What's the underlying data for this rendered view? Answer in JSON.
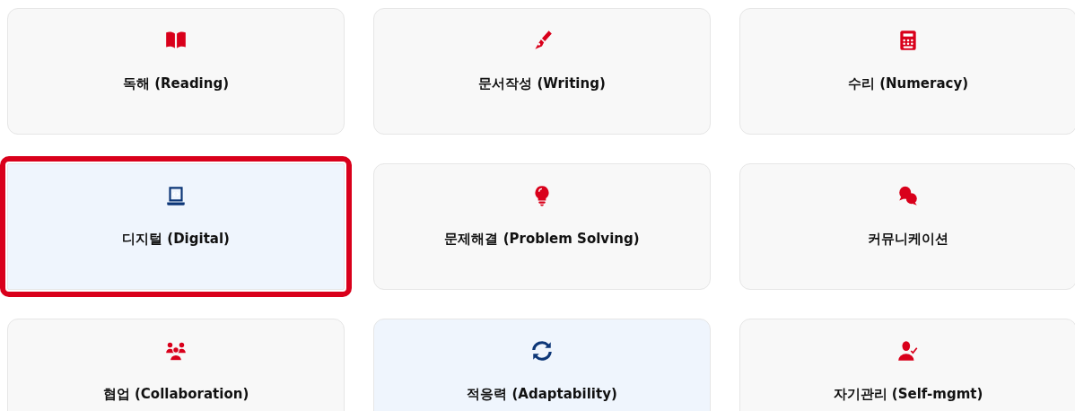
{
  "cards": [
    {
      "label": "독해 (Reading)",
      "selected": false,
      "hovered": false
    },
    {
      "label": "문서작성 (Writing)",
      "selected": false,
      "hovered": false
    },
    {
      "label": "수리 (Numeracy)",
      "selected": false,
      "hovered": false
    },
    {
      "label": "디지털 (Digital)",
      "selected": true,
      "hovered": false
    },
    {
      "label": "문제해결 (Problem Solving)",
      "selected": false,
      "hovered": false
    },
    {
      "label": "커뮤니케이션",
      "selected": false,
      "hovered": false
    },
    {
      "label": "협업 (Collaboration)",
      "selected": false,
      "hovered": false
    },
    {
      "label": "적응력 (Adaptability)",
      "selected": false,
      "hovered": true
    },
    {
      "label": "자기관리 (Self-mgmt)",
      "selected": false,
      "hovered": false
    }
  ]
}
